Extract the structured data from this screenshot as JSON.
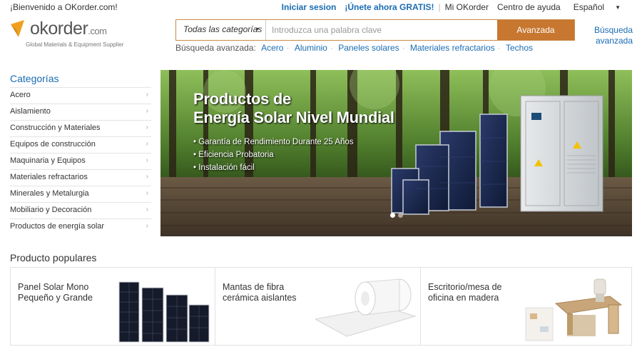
{
  "topbar": {
    "welcome": "¡Bienvenido a OKorder.com!",
    "signin": "Iniciar sesion",
    "join": "¡Únete ahora GRATIS!",
    "my_account": "Mi OKorder",
    "help": "Centro de ayuda",
    "language": "Español"
  },
  "logo": {
    "name": "okorder",
    "suffix": ".com",
    "tagline": "Global Materials & Equipment Supplier"
  },
  "search": {
    "category": "Todas las categorías",
    "placeholder": "Introduzca una palabra clave",
    "value": "",
    "button": "Avanzada",
    "advanced_link_line1": "Búsqueda",
    "advanced_link_line2": "avanzada",
    "quick_label": "Búsqueda avanzada:",
    "quick_links": [
      "Acero",
      "Aluminio",
      "Paneles solares",
      "Materiales refractarios",
      "Techos"
    ]
  },
  "categories": {
    "title": "Categorías",
    "items": [
      "Acero",
      "Aislamiento",
      "Construcción y Materiales",
      "Equipos de construcción",
      "Maquinaria y Equipos",
      "Materiales refractarios",
      "Minerales y Metalurgia",
      "Mobiliario y Decoración",
      "Productos de energía solar"
    ]
  },
  "banner": {
    "title_line1": "Productos de",
    "title_line2": "Energía Solar Nivel Mundial",
    "bullets": [
      "• Garantía de Rendimiento Durante 25 Años",
      "• Eficiencia Probatoria",
      "• Instalación fácil"
    ],
    "slide_count": 2,
    "active_slide": 1
  },
  "popular": {
    "title": "Producto populares",
    "items": [
      {
        "label": "Panel Solar Mono Pequeño y Grande",
        "image": "solar-panels"
      },
      {
        "label": "Mantas de fibra cerámica aislantes",
        "image": "ceramic-fiber-blanket"
      },
      {
        "label": "Escritorio/mesa de oficina en madera",
        "image": "office-desk"
      }
    ]
  },
  "colors": {
    "link_blue": "#1a6cb3",
    "search_button": "#c7772f",
    "logo_orange": "#f0a020"
  }
}
